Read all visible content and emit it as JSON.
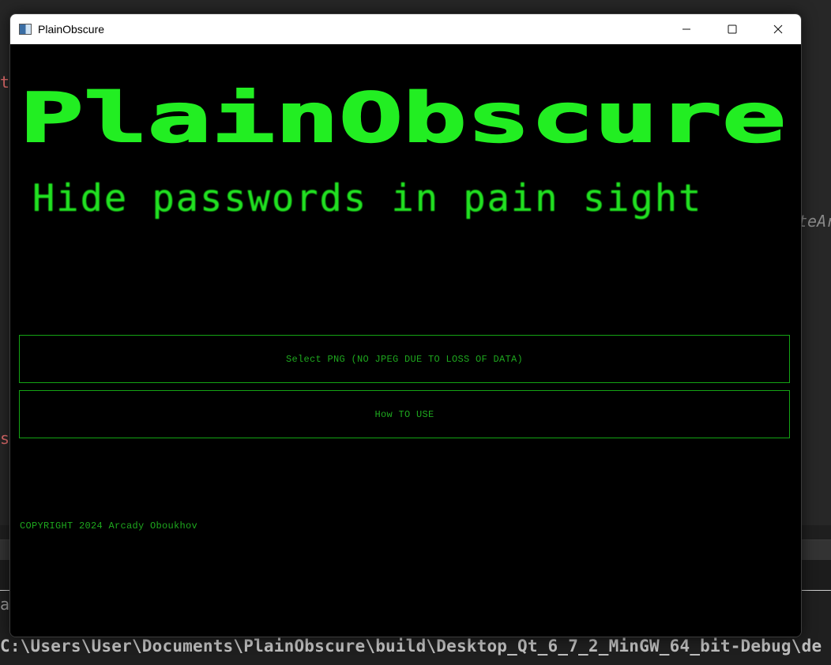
{
  "background": {
    "fragments": {
      "left_top": "t",
      "left_mid": "s",
      "right_mid": "teAr",
      "left_bottom": "a"
    },
    "terminal_path": "C:\\Users\\User\\Documents\\PlainObscure\\build\\Desktop_Qt_6_7_2_MinGW_64_bit-Debug\\de"
  },
  "window": {
    "title": "PlainObscure",
    "controls": {
      "minimize": "minimize-icon",
      "maximize": "maximize-icon",
      "close": "close-icon"
    }
  },
  "app": {
    "logo_text": "PlainObscure",
    "tagline": "Hide passwords in pain sight",
    "buttons": {
      "select_png": "Select PNG (NO JPEG DUE TO LOSS OF DATA)",
      "how_to_use": "How TO USE"
    },
    "copyright": "COPYRIGHT 2024 Arcady Oboukhov"
  },
  "colors": {
    "accent_green": "#22e022",
    "button_green": "#1ea81e",
    "window_bg": "#000000"
  }
}
